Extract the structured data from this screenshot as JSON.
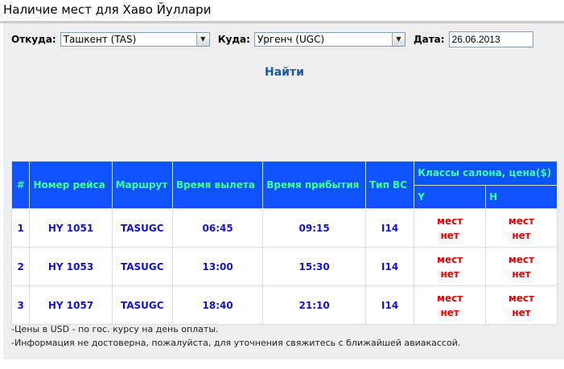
{
  "page": {
    "title": "Наличие мест для Хаво Йуллари"
  },
  "form": {
    "from_label": "Откуда:",
    "from_value": "Ташкент (TAS)",
    "to_label": "Куда:",
    "to_value": "Ургенч (UGC)",
    "date_label": "Дата:",
    "date_value": "26.06.2013",
    "search_label": "Найти"
  },
  "table": {
    "headers": {
      "num": "#",
      "flight": "Номер рейса",
      "route": "Маршрут",
      "departure": "Время вылета",
      "arrival": "Время прибытия",
      "aircraft": "Тип ВС",
      "classes": "Классы салона, цена($)",
      "class_y": "Y",
      "class_h": "H"
    },
    "rows": [
      {
        "num": "1",
        "flight": "HY 1051",
        "route": "TASUGC",
        "departure": "06:45",
        "arrival": "09:15",
        "aircraft": "I14",
        "y_line1": "мест",
        "y_line2": "нет",
        "h_line1": "мест",
        "h_line2": "нет"
      },
      {
        "num": "2",
        "flight": "HY 1053",
        "route": "TASUGC",
        "departure": "13:00",
        "arrival": "15:30",
        "aircraft": "I14",
        "y_line1": "мест",
        "y_line2": "нет",
        "h_line1": "мест",
        "h_line2": "нет"
      },
      {
        "num": "3",
        "flight": "HY 1057",
        "route": "TASUGC",
        "departure": "18:40",
        "arrival": "21:10",
        "aircraft": "I14",
        "y_line1": "мест",
        "y_line2": "нет",
        "h_line1": "мест",
        "h_line2": "нет"
      }
    ]
  },
  "notes": {
    "line1": "-Цены в USD - по гос. курсу на день оплаты.",
    "line2": "-Информация не достоверна, пожалуйста, для уточнения свяжитесь с ближайшей авиакассой."
  },
  "icons": {
    "dropdown": "chevron-down-icon"
  },
  "colors": {
    "header_bg": "#0f52ff",
    "header_text": "#3cff9c",
    "cell_text": "#1212d2",
    "unavailable_text": "#e80000",
    "link": "#1a5aa0",
    "panel_bg": "#eeeeee"
  }
}
